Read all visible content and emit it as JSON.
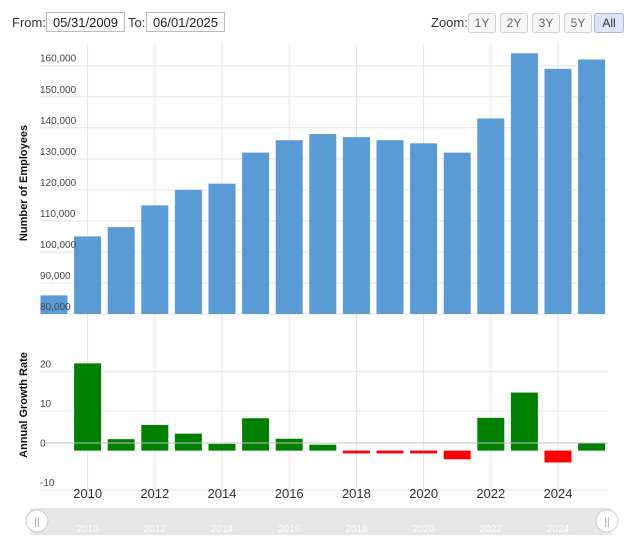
{
  "toolbar": {
    "from_label": "From:",
    "from_value": "05/31/2009",
    "to_label": "To:",
    "to_value": "06/01/2025",
    "zoom_label": "Zoom:",
    "zoom_options": [
      "1Y",
      "2Y",
      "3Y",
      "5Y",
      "All"
    ],
    "active_zoom": "All"
  },
  "colors": {
    "bar": "#5b9bd5",
    "positive": "#008000",
    "negative": "#ff0000",
    "grid": "#e4e4e4",
    "navigator": "#e6e6e6"
  },
  "chart_data": [
    {
      "type": "bar",
      "ylabel": "Number of Employees",
      "x": [
        2009,
        2010,
        2011,
        2012,
        2013,
        2014,
        2015,
        2016,
        2017,
        2018,
        2019,
        2020,
        2021,
        2022,
        2023,
        2024,
        2025
      ],
      "values": [
        86000,
        105000,
        108000,
        115000,
        120000,
        122000,
        132000,
        136000,
        138000,
        137000,
        136000,
        135000,
        132000,
        143000,
        164000,
        159000,
        162000
      ],
      "ylim": [
        80000,
        167000
      ],
      "yticks": [
        "80,000",
        "90,000",
        "100,000",
        "110,000",
        "120,000",
        "130,000",
        "140,000",
        "150,000",
        "160,000"
      ],
      "grid": true
    },
    {
      "type": "bar",
      "ylabel": "Annual Growth Rate",
      "x": [
        2010,
        2011,
        2012,
        2013,
        2014,
        2015,
        2016,
        2017,
        2018,
        2019,
        2020,
        2021,
        2022,
        2023,
        2024,
        2025
      ],
      "values": [
        22.1,
        2.9,
        6.5,
        4.3,
        1.7,
        8.2,
        3.0,
        1.5,
        -0.7,
        -0.7,
        -0.7,
        -2.2,
        8.3,
        14.7,
        -3.0,
        1.9
      ],
      "ylim": [
        -12,
        27
      ],
      "yticks": [
        "20",
        "10",
        "0",
        "-10"
      ],
      "grid": true
    }
  ],
  "xaxis": {
    "tick_labels": [
      "2010",
      "2012",
      "2014",
      "2016",
      "2018",
      "2020",
      "2022",
      "2024"
    ]
  },
  "navigator": {
    "tick_labels": [
      "2010",
      "2012",
      "2014",
      "2016",
      "2018",
      "2020",
      "2022",
      "2024"
    ],
    "handle_glyph": "||"
  }
}
